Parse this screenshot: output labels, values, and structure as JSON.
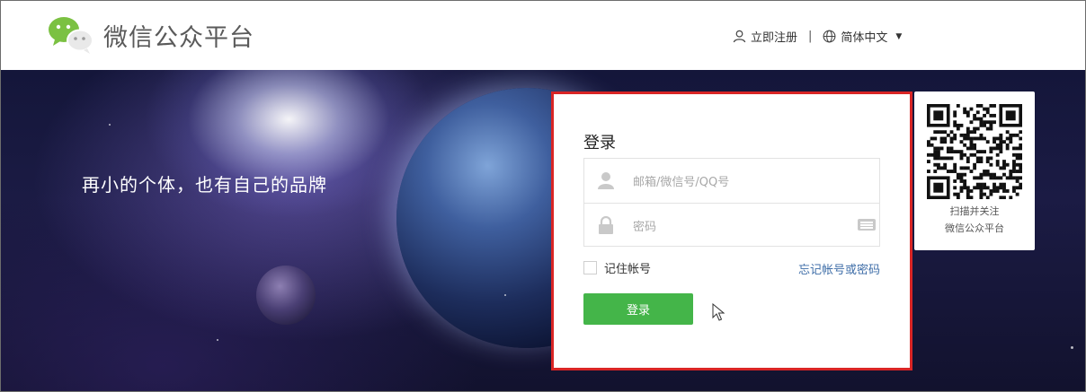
{
  "header": {
    "logo_title": "微信公众平台",
    "register_label": "立即注册",
    "separator": "|",
    "language_label": "简体中文"
  },
  "banner": {
    "slogan": "再小的个体，也有自己的品牌"
  },
  "login": {
    "title": "登录",
    "account_placeholder": "邮箱/微信号/QQ号",
    "password_placeholder": "密码",
    "remember_label": "记住帐号",
    "forgot_label": "忘记帐号或密码",
    "submit_label": "登录"
  },
  "qr": {
    "line1": "扫描并关注",
    "line2": "微信公众平台"
  },
  "colors": {
    "brand_green": "#44b549",
    "highlight_red": "#d92525",
    "link_blue": "#3f6ea8"
  },
  "icons": {
    "logo": "wechat-logo-icon",
    "user": "user-icon",
    "globe": "globe-icon",
    "lock": "lock-icon",
    "keyboard": "keyboard-icon",
    "caret": "chevron-down-icon"
  }
}
